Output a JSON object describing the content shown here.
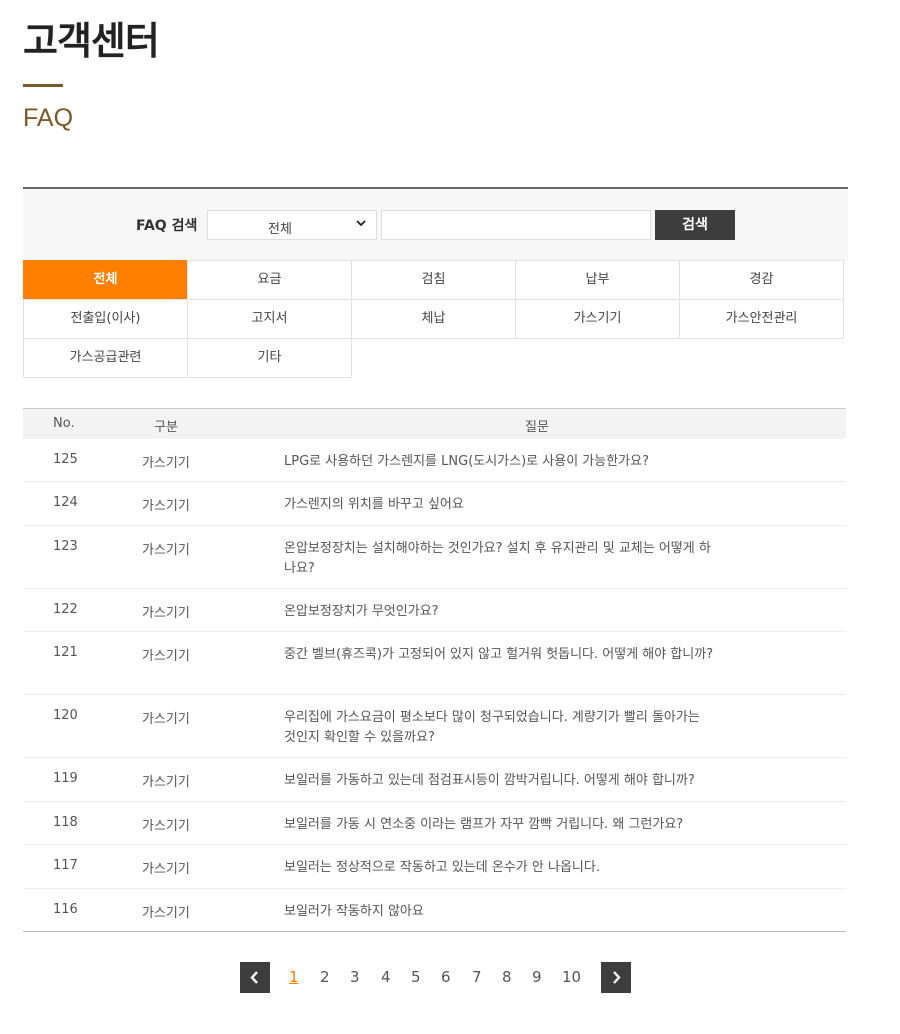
{
  "header": {
    "title": "고객센터",
    "subtitle": "FAQ"
  },
  "search": {
    "label": "FAQ 검색",
    "select_value": "전체",
    "input_value": "",
    "button_label": "검색"
  },
  "categories": [
    "전체",
    "요금",
    "검침",
    "납부",
    "경감",
    "전출입(이사)",
    "고지서",
    "체납",
    "가스기기",
    "가스안전관리",
    "가스공급관련",
    "기타"
  ],
  "active_category": "전체",
  "table": {
    "headers": {
      "no": "No.",
      "category": "구분",
      "question": "질문"
    },
    "rows": [
      {
        "no": "125",
        "category": "가스기기",
        "question": "LPG로 사용하던 가스렌지를 LNG(도시가스)로 사용이 가능한가요?"
      },
      {
        "no": "124",
        "category": "가스기기",
        "question": "가스렌지의 위치를 바꾸고 싶어요"
      },
      {
        "no": "123",
        "category": "가스기기",
        "question": "온압보정장치는 설치해야하는 것인가요? 설치 후 유지관리 및 교체는 어떻게 하나요?"
      },
      {
        "no": "122",
        "category": "가스기기",
        "question": "온압보정장치가 무엇인가요?"
      },
      {
        "no": "121",
        "category": "가스기기",
        "question": "중간 벨브(휴즈콕)가 고정되어 있지 않고 헐거워 헛돕니다. 어떻게 해야 합니까?"
      },
      {
        "no": "120",
        "category": "가스기기",
        "question": "우리집에 가스요금이 평소보다 많이 청구되었습니다. 계량기가 빨리 돌아가는 것인지 확인할 수 있을까요?"
      },
      {
        "no": "119",
        "category": "가스기기",
        "question": "보일러를 가동하고 있는데 점검표시등이 깜박거립니다. 어떻게 해야 합니까?"
      },
      {
        "no": "118",
        "category": "가스기기",
        "question": "보일러를 가동 시 연소중 이라는 램프가 자꾸 깜빡 거립니다. 왜 그런가요?"
      },
      {
        "no": "117",
        "category": "가스기기",
        "question": "보일러는 정상적으로 작동하고 있는데 온수가 안 나옵니다."
      },
      {
        "no": "116",
        "category": "가스기기",
        "question": "보일러가 작동하지 않아요"
      }
    ]
  },
  "pagination": {
    "pages": [
      "1",
      "2",
      "3",
      "4",
      "5",
      "6",
      "7",
      "8",
      "9",
      "10"
    ],
    "current": "1"
  },
  "colors": {
    "accent": "#ff7f00",
    "brand_brown": "#7a5a2a",
    "dark_button": "#3d3d3d"
  },
  "icons": {
    "prev": "chevron-left-icon",
    "next": "chevron-right-icon",
    "select": "chevron-down-icon"
  }
}
